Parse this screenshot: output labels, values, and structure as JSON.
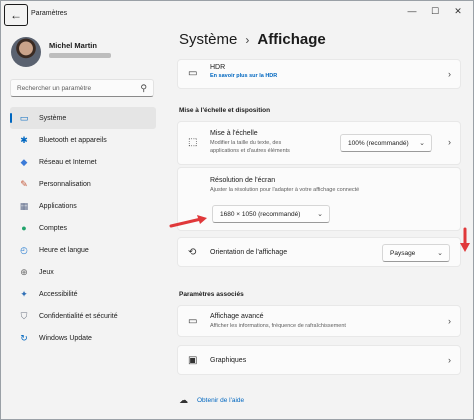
{
  "window": {
    "title": "Paramètres",
    "controls": [
      "—",
      "☐",
      "✕"
    ]
  },
  "user": {
    "name": "Michel Martin"
  },
  "search": {
    "placeholder": "Rechercher un paramètre"
  },
  "nav": [
    {
      "label": "Système",
      "icon": "display-icon",
      "glyph": "▭",
      "color": "#0067c0"
    },
    {
      "label": "Bluetooth et appareils",
      "icon": "bluetooth-icon",
      "glyph": "✱",
      "color": "#0067c0"
    },
    {
      "label": "Réseau et Internet",
      "icon": "wifi-icon",
      "glyph": "◆",
      "color": "#3b7bd8"
    },
    {
      "label": "Personnalisation",
      "icon": "brush-icon",
      "glyph": "✎",
      "color": "#c4583a"
    },
    {
      "label": "Applications",
      "icon": "apps-icon",
      "glyph": "▦",
      "color": "#5e6b8a"
    },
    {
      "label": "Comptes",
      "icon": "account-icon",
      "glyph": "●",
      "color": "#21a36b"
    },
    {
      "label": "Heure et langue",
      "icon": "clock-globe-icon",
      "glyph": "◴",
      "color": "#2d7fd1"
    },
    {
      "label": "Jeux",
      "icon": "gamepad-icon",
      "glyph": "⊕",
      "color": "#6b6b6b"
    },
    {
      "label": "Accessibilité",
      "icon": "accessibility-icon",
      "glyph": "✦",
      "color": "#2f6fb6"
    },
    {
      "label": "Confidentialité et sécurité",
      "icon": "shield-icon",
      "glyph": "⛉",
      "color": "#6b7280"
    },
    {
      "label": "Windows Update",
      "icon": "update-icon",
      "glyph": "↻",
      "color": "#0067c0"
    }
  ],
  "header": {
    "parent": "Système",
    "separator": "›",
    "current": "Affichage"
  },
  "hdr_card": {
    "title": "HDR",
    "link": "En savoir plus sur la HDR"
  },
  "scale_section": {
    "heading": "Mise à l'échelle et disposition"
  },
  "scale_card": {
    "title": "Mise à l'échelle",
    "subtitle_line1": "Modifier la taille du texte, des",
    "subtitle_line2": "applications et d'autres éléments",
    "value": "100% (recommandé)"
  },
  "resolution_card": {
    "title": "Résolution de l'écran",
    "subtitle": "Ajuster  la résolution pour l'adapter à votre  affichage connecté",
    "value": "1680 × 1050 (recommandé)"
  },
  "orientation_card": {
    "title": "Orientation de l'affichage",
    "value": "Paysage"
  },
  "related_section": {
    "heading": "Paramètres associés"
  },
  "advanced_card": {
    "title": "Affichage avancé",
    "subtitle": "Afficher les informations, fréquence de rafraîchissement"
  },
  "graphics_card": {
    "title": "Graphiques"
  },
  "help": {
    "label": "Obtenir de l'aide"
  },
  "colors": {
    "accent": "#0067c0",
    "annotation_arrow": "#e0383a"
  }
}
